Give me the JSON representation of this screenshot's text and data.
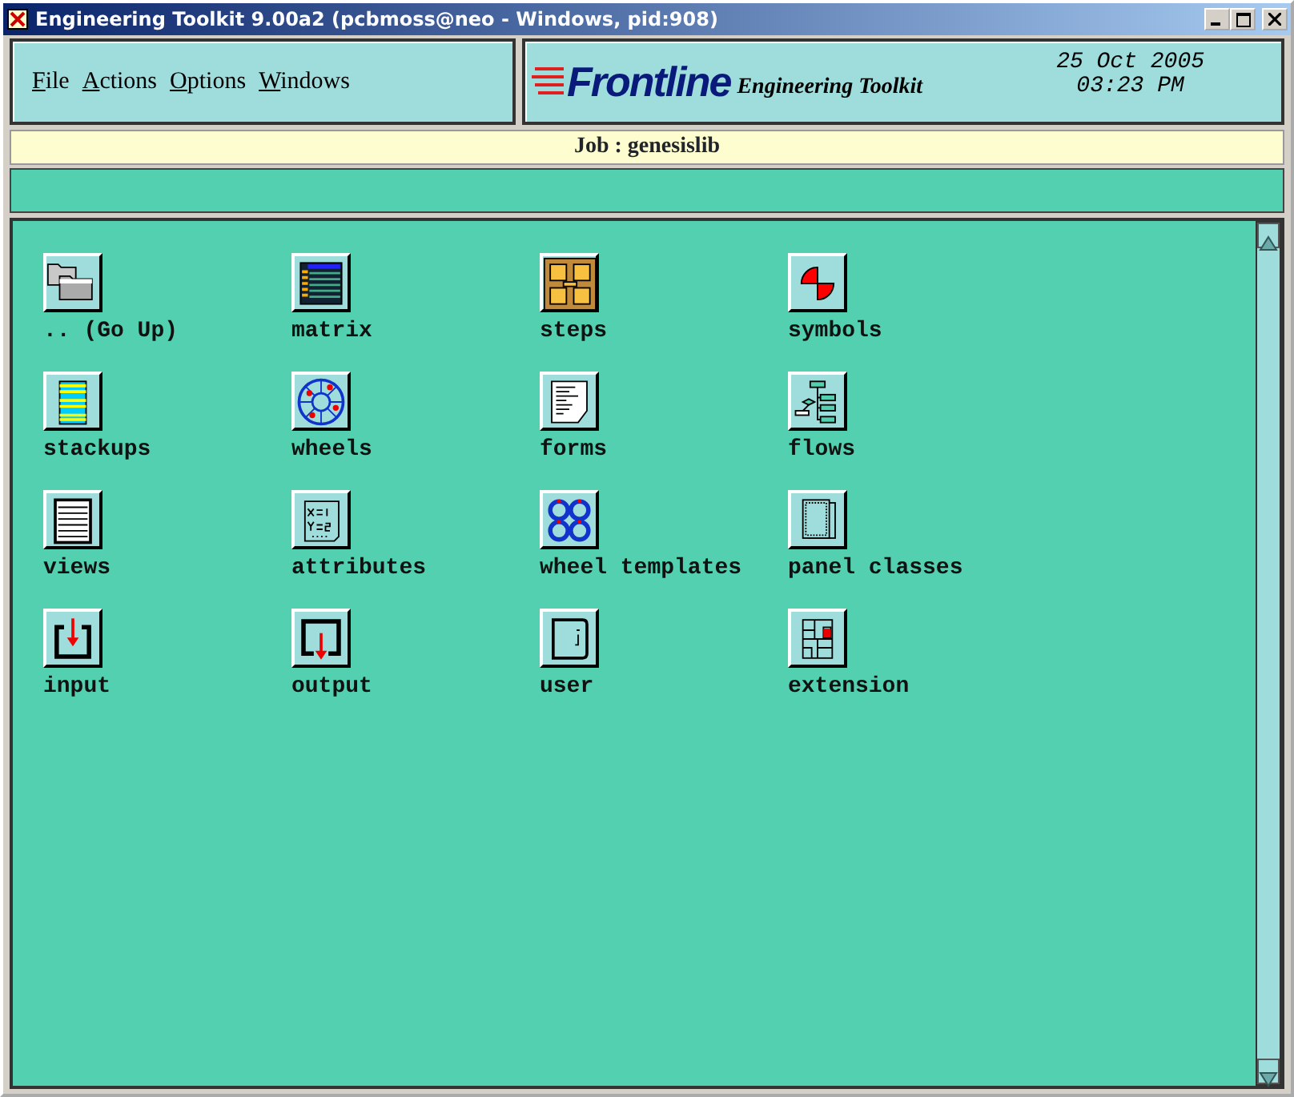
{
  "window": {
    "title": "Engineering Toolkit 9.00a2 (pcbmoss@neo - Windows, pid:908)"
  },
  "menu": [
    "File",
    "Actions",
    "Options",
    "Windows"
  ],
  "brand": {
    "logo": "Frontline",
    "subtitle": "Engineering Toolkit",
    "date": "25 Oct 2005",
    "time": "03:23 PM"
  },
  "job_bar": "Job : genesislib",
  "items": [
    {
      "label": ".. (Go Up)",
      "kind": "folder"
    },
    {
      "label": "matrix",
      "kind": "matrix"
    },
    {
      "label": "steps",
      "kind": "steps"
    },
    {
      "label": "symbols",
      "kind": "symbols"
    },
    {
      "label": "stackups",
      "kind": "stackups"
    },
    {
      "label": "wheels",
      "kind": "wheel"
    },
    {
      "label": "forms",
      "kind": "form"
    },
    {
      "label": "flows",
      "kind": "flow"
    },
    {
      "label": "views",
      "kind": "view"
    },
    {
      "label": "attributes",
      "kind": "attributes"
    },
    {
      "label": "wheel templates",
      "kind": "wheels"
    },
    {
      "label": "panel classes",
      "kind": "panel"
    },
    {
      "label": "input",
      "kind": "input"
    },
    {
      "label": "output",
      "kind": "output"
    },
    {
      "label": "user",
      "kind": "user"
    },
    {
      "label": "extension",
      "kind": "extension"
    }
  ]
}
